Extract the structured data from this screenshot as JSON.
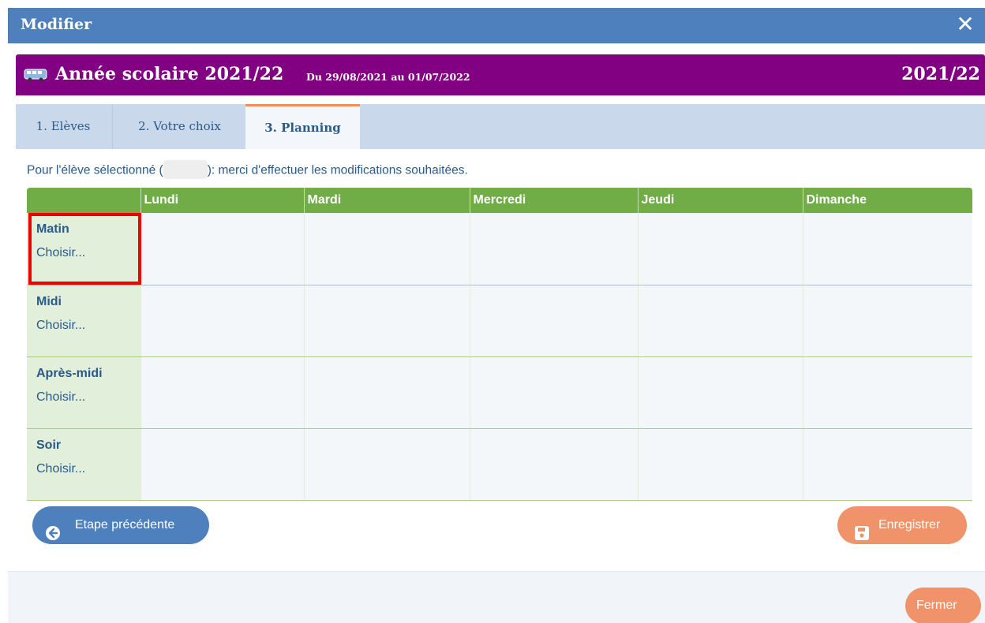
{
  "dialog": {
    "title": "Modifier",
    "close_glyph": "✕"
  },
  "year": {
    "title": "Année scolaire 2021/22",
    "dates": "Du 29/08/2021 au 01/07/2022",
    "code": "2021/22",
    "icon": "bus-icon"
  },
  "tabs": [
    {
      "label": "1. Elèves"
    },
    {
      "label": "2. Votre choix"
    },
    {
      "label": "3. Planning",
      "active": true
    }
  ],
  "info": {
    "prefix": "Pour l'élève sélectionné (",
    "suffix": "): merci d'effectuer les modifications souhaitées."
  },
  "planning": {
    "columns": [
      "",
      "Lundi",
      "Mardi",
      "Mercredi",
      "Jeudi",
      "Dimanche"
    ],
    "rows": [
      {
        "slot": "Matin",
        "choose": "Choisir..."
      },
      {
        "slot": "Midi",
        "choose": "Choisir..."
      },
      {
        "slot": "Après-midi",
        "choose": "Choisir..."
      },
      {
        "slot": "Soir",
        "choose": "Choisir..."
      }
    ]
  },
  "buttons": {
    "prev": "Etape précédente",
    "save": "Enregistrer",
    "close": "Fermer"
  },
  "colors": {
    "header": "#4e80bd",
    "year_bar": "#820082",
    "table_header": "#70ad47",
    "accent": "#f0936a",
    "highlight": "#ee0000"
  }
}
